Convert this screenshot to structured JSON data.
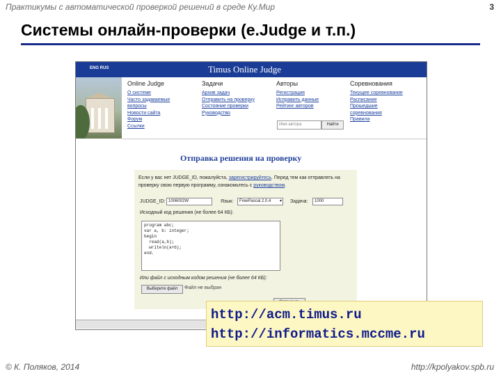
{
  "header": {
    "course": "Практикумы с автоматической проверкой решений в среде Ку.Мир",
    "slide_number": "3"
  },
  "title": "Системы онлайн-проверки (e.Judge и т.п.)",
  "site": {
    "lang": "ENG RUS",
    "name": "Timus Online Judge",
    "menus": [
      {
        "title": "Online Judge",
        "links": [
          "О системе",
          "Часто задаваемые",
          "вопросы",
          "Новости сайта",
          "Форум",
          "Ссылки"
        ]
      },
      {
        "title": "Задачи",
        "links": [
          "Архив задач",
          "Отправить на проверку",
          "Состояние проверки",
          "Руководство"
        ]
      },
      {
        "title": "Авторы",
        "links": [
          "Регистрация",
          "Исправить данные",
          "Рейтинг авторов"
        ]
      },
      {
        "title": "Соревнования",
        "links": [
          "Текущее соревнование",
          "Расписание",
          "Прошедшие",
          "соревнования",
          "Правила"
        ]
      }
    ],
    "author_search": {
      "placeholder": "Имя автора",
      "button": "Найти"
    },
    "submit": {
      "heading": "Отправка решения на проверку",
      "intro_prefix": "Если у вас нет JUDGE_ID, пожалуйста,",
      "intro_link": "зарегистрируйтесь",
      "intro_mid": ". Перед тем как отправлять на проверку свою первую программу, ознакомьтесь с",
      "intro_link2": "руководством",
      "intro_suffix": ".",
      "judge_id_label": "JUDGE_ID:",
      "judge_id_value": "1006002W",
      "language_label": "Язык:",
      "language_value": "FreePascal 2.0.4",
      "problem_label": "Задача:",
      "problem_value": "1000",
      "source_label": "Исходный код решения (не более 64 КБ):",
      "code_lines": [
        "program abc;",
        "var a, b: integer;",
        "begin",
        "  read(a,b);",
        "  writeln(a+b);",
        "end."
      ],
      "file_label": "Или файл с исходным кодом решения (не более 64 КБ):",
      "file_button": "Выберите файл",
      "file_status": "Файл не выбран",
      "send_button": "Отправить"
    }
  },
  "urls": [
    "http://acm.timus.ru",
    "http://informatics.mccme.ru"
  ],
  "footer": {
    "author": "© К. Поляков, 2014",
    "site": "http://kpolyakov.spb.ru"
  }
}
